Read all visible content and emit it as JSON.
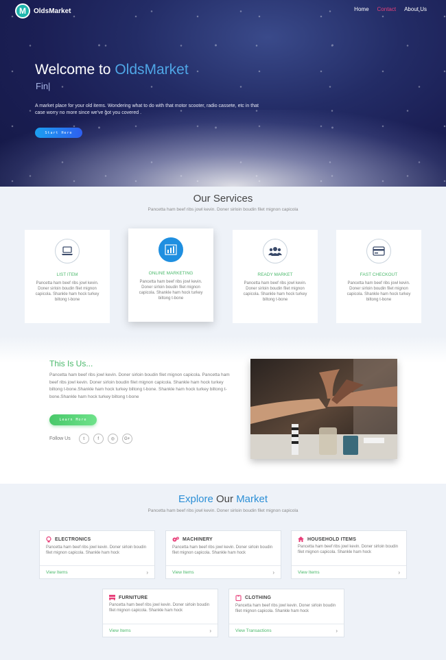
{
  "brand": {
    "logo_letter": "M",
    "name": "OldsMarket"
  },
  "nav": {
    "items": [
      "Home",
      "Contact",
      "About Us"
    ],
    "active": "Contact"
  },
  "hero": {
    "title_prefix": "Welcome to ",
    "title_brand": "OldsMarket",
    "typed": "Fin|",
    "description": "A market place for your old items. Wondering what to do with that motor scooter, radio cassete, etc in that case worry no more since we've got you covered .",
    "button": "Start Here",
    "colors": {
      "brand_text": "#4fa6e6",
      "button": "#1c9ff0"
    }
  },
  "services": {
    "title": "Our Services",
    "subtitle": "Pancetta ham beef ribs jowl kevin. Doner sirloin boudin filet mignon capicola",
    "items": [
      {
        "icon": "laptop-icon",
        "title": "LIST ITEM",
        "text": "Pancetta ham beef ribs jowl kevin. Doner sirloin boudin filet mignon capicola. Shankle ham hock turkey biltong t-bone"
      },
      {
        "icon": "bar-chart-icon",
        "title": "ONLINE MARKETING",
        "text": "Pancetta ham beef ribs jowl kevin. Doner sirloin boudin filet mignon capicola. Shankle ham hock turkey biltong t-bone"
      },
      {
        "icon": "users-icon",
        "title": "READY MARKET",
        "text": "Pancetta ham beef ribs jowl kevin. Doner sirloin boudin filet mignon capicola. Shankle ham hock turkey biltong t-bone"
      },
      {
        "icon": "credit-card-icon",
        "title": "FAST CHECKOUT",
        "text": "Pancetta ham beef ribs jowl kevin. Doner sirloin boudin filet mignon capicola. Shankle ham hock turkey biltong t-bone"
      }
    ]
  },
  "about": {
    "title": "This Is Us...",
    "text": "Pancetta ham beef ribs jowl kevin. Doner sirloin boudin filet mignon capicola. Pancetta ham beef ribs jowl kevin. Doner sirloin boudin filet mignon capicola. Shankle ham hock turkey biltong t-bone.Shankle ham hock turkey biltong t-bone. Shankle ham hock turkey biltong t-bone.Shankle ham hock turkey biltong t-bone",
    "button": "Learn More",
    "follow_label": "Follow Us",
    "social": [
      {
        "icon": "twitter-icon",
        "glyph": "t"
      },
      {
        "icon": "facebook-icon",
        "glyph": "f"
      },
      {
        "icon": "instagram-icon",
        "glyph": "◎"
      },
      {
        "icon": "google-plus-icon",
        "glyph": "G+"
      }
    ]
  },
  "market": {
    "title_a": "Explore ",
    "title_b": "Our ",
    "title_c": "Market",
    "subtitle": "Pancetta ham beef ribs jowl kevin. Doner sirloin boudin filet mignon capicola",
    "cards": [
      {
        "icon": "lightbulb-icon",
        "color": "#e8407a",
        "title": "ELECTRONICS",
        "text": "Pancetta ham beef ribs jowl kevin. Doner sirloin boudin filet mignon capicola. Shankle ham hock",
        "link": "View Items"
      },
      {
        "icon": "gears-icon",
        "color": "#e8407a",
        "title": "MACHINERY",
        "text": "Pancetta ham beef ribs jowl kevin. Doner sirloin boudin filet mignon capicola. Shankle ham hock",
        "link": "View Items"
      },
      {
        "icon": "home-icon",
        "color": "#e8407a",
        "title": "HOUSEHOLD ITEMS",
        "text": "Pancetta ham beef ribs jowl kevin. Doner sirloin boudin filet mignon capicola. Shankle ham hock",
        "link": "View Items"
      },
      {
        "icon": "sofa-icon",
        "color": "#e8407a",
        "title": "FURNITURE",
        "text": "Pancetta ham beef ribs jowl kevin. Doner sirloin boudin filet mignon capicola. Shankle ham hock",
        "link": "View Items"
      },
      {
        "icon": "shirt-icon",
        "color": "#e8407a",
        "title": "CLOTHING",
        "text": "Pancetta ham beef ribs jowl kevin. Doner sirloin boudin filet mignon capicola. Shankle ham hock",
        "link": "View Transactions"
      }
    ]
  }
}
